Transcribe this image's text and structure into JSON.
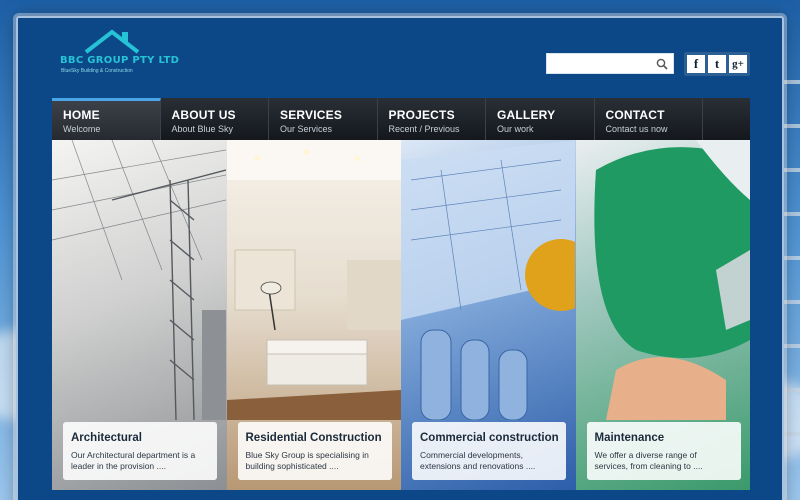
{
  "site": {
    "logo_name": "BBC GROUP PTY LTD",
    "logo_tagline": "BlueSky Building & Construction"
  },
  "search": {
    "value": "",
    "placeholder": ""
  },
  "social": [
    {
      "label": "f",
      "icon": "facebook-icon"
    },
    {
      "label": "t",
      "icon": "twitter-icon"
    },
    {
      "label": "g+",
      "icon": "google-plus-icon"
    }
  ],
  "nav": [
    {
      "label": "HOME",
      "sub": "Welcome",
      "active": true
    },
    {
      "label": "ABOUT US",
      "sub": "About Blue Sky",
      "active": false
    },
    {
      "label": "SERVICES",
      "sub": "Our Services",
      "active": false
    },
    {
      "label": "PROJECTS",
      "sub": "Recent / Previous",
      "active": false
    },
    {
      "label": "GALLERY",
      "sub": "Our work",
      "active": false
    },
    {
      "label": "CONTACT",
      "sub": "Contact us now",
      "active": false
    }
  ],
  "panels": [
    {
      "title": "Architectural",
      "text": "Our Architectural department is a leader in the provision ...."
    },
    {
      "title": "Residential Construction",
      "text": "Blue Sky Group is specialising in building sophisticated ...."
    },
    {
      "title": "Commercial construction",
      "text": "Commercial developments, extensions and renovations ...."
    },
    {
      "title": "Maintenance",
      "text": "We offer a diverse range of services, from cleaning to ...."
    }
  ],
  "colors": {
    "frame": "#0c4887",
    "nav": "#1b2026",
    "accent": "#4aa6e8",
    "logo": "#26c3d6"
  }
}
